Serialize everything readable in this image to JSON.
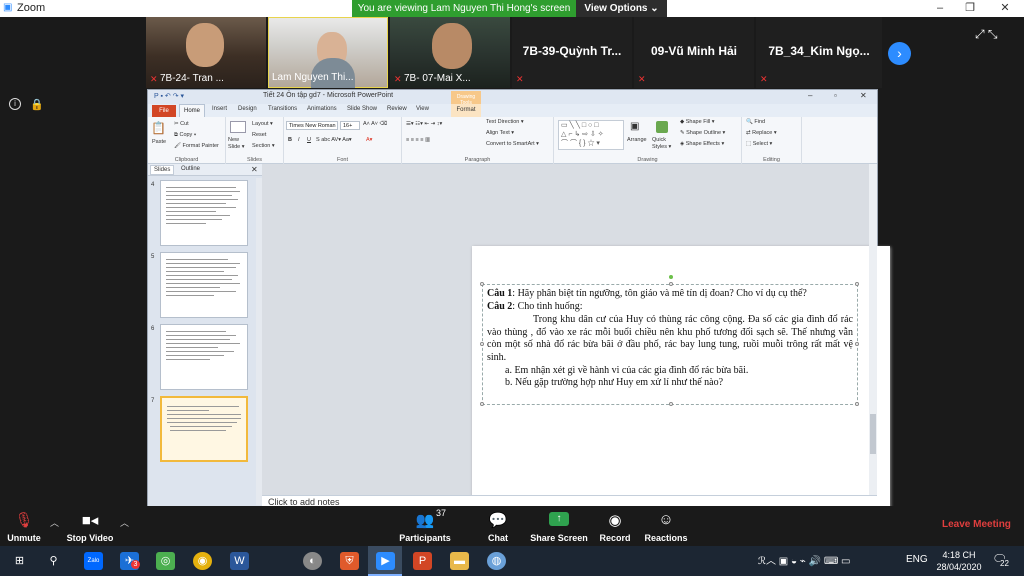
{
  "app": {
    "title": "Zoom",
    "window_controls": [
      "–",
      "❐",
      "✕"
    ]
  },
  "banner": {
    "viewing_text": "You are viewing Lam Nguyen Thi Hong's screen",
    "view_options": "View Options ⌄"
  },
  "gallery": {
    "participants": [
      {
        "name": "7B-24- Tran ..."
      },
      {
        "name": "Lam Nguyen Thi..."
      },
      {
        "name": "7B- 07-Mai X..."
      },
      {
        "name": "7B-39-Quỳnh Tr..."
      },
      {
        "name": "09-Vũ Minh Hải"
      },
      {
        "name": "7B_34_Kim Ngọ..."
      }
    ],
    "next_icon": "›"
  },
  "ppt": {
    "window_title": "Tiết 24 Ôn tập gd7 - Microsoft PowerPoint",
    "contextual_group": "Drawing Tools",
    "tabs": [
      "File",
      "Home",
      "Insert",
      "Design",
      "Transitions",
      "Animations",
      "Slide Show",
      "Review",
      "View",
      "Format"
    ],
    "ribbon": {
      "clipboard": {
        "paste": "Paste",
        "cut": "Cut",
        "copy": "Copy ▾",
        "format_painter": "Format Painter",
        "label": "Clipboard"
      },
      "slides": {
        "new_slide": "New Slide ▾",
        "layout": "Layout ▾",
        "reset": "Reset",
        "section": "Section ▾",
        "label": "Slides"
      },
      "font": {
        "font_name": "Times New Roman",
        "font_size": "16+",
        "label": "Font"
      },
      "paragraph": {
        "text_direction": "Text Direction ▾",
        "align_text": "Align Text ▾",
        "smartart": "Convert to SmartArt ▾",
        "label": "Paragraph"
      },
      "drawing": {
        "arrange": "Arrange",
        "quick_styles": "Quick Styles ▾",
        "shape_fill": "Shape Fill ▾",
        "shape_outline": "Shape Outline ▾",
        "shape_effects": "Shape Effects ▾",
        "label": "Drawing"
      },
      "editing": {
        "find": "Find",
        "replace": "Replace ▾",
        "select": "Select ▾",
        "label": "Editing"
      }
    },
    "pane_tabs": [
      "Slides",
      "Outline"
    ],
    "thumbnails": [
      {
        "number": "4",
        "selected": false
      },
      {
        "number": "5",
        "selected": false
      },
      {
        "number": "6",
        "selected": false
      },
      {
        "number": "7",
        "selected": true
      }
    ],
    "slide": {
      "q1_label": "Câu 1",
      "q1_text": ": Hãy phân biệt tín ngưỡng, tôn giáo và mê tín dị đoan? Cho ví dụ cụ thể?",
      "q2_label": "Câu 2",
      "q2_text": ": Cho tình huống:",
      "para": "Trong  khu dân cư của Huy có thùng rác công cộng. Đa số các gia đình đổ rác vào thùng , đổ vào xe rác mỗi buổi chiều nên khu phố tương đối sạch sẽ. Thế nhưng vẫn còn một số nhà đổ rác bừa bãi ở đầu phố, rác bay lung tung, ruồi muỗi trông rất mất vệ sinh.",
      "item_a": "a.   Em nhận xét gì về hành vi của các gia đình đổ rác bừa bãi.",
      "item_b": "b.   Nếu gặp trường hợp như Huy em xử lí như thế nào?"
    },
    "notes_placeholder": "Click to add notes"
  },
  "controls": {
    "unmute": "Unmute",
    "stop_video": "Stop Video",
    "participants": "Participants",
    "participants_count": "37",
    "chat": "Chat",
    "share_screen": "Share Screen",
    "record": "Record",
    "reactions": "Reactions",
    "leave": "Leave Meeting"
  },
  "taskbar": {
    "language": "ENG",
    "time": "4:18 CH",
    "date": "28/04/2020",
    "notifications": "22",
    "zalo_label": "Zalo",
    "badge": "3"
  },
  "colors": {
    "banner_green": "#2f9e2f",
    "zoom_blue": "#2d8cff",
    "leave_red": "#e03e3e",
    "ppt_file_tab": "#d24625"
  }
}
